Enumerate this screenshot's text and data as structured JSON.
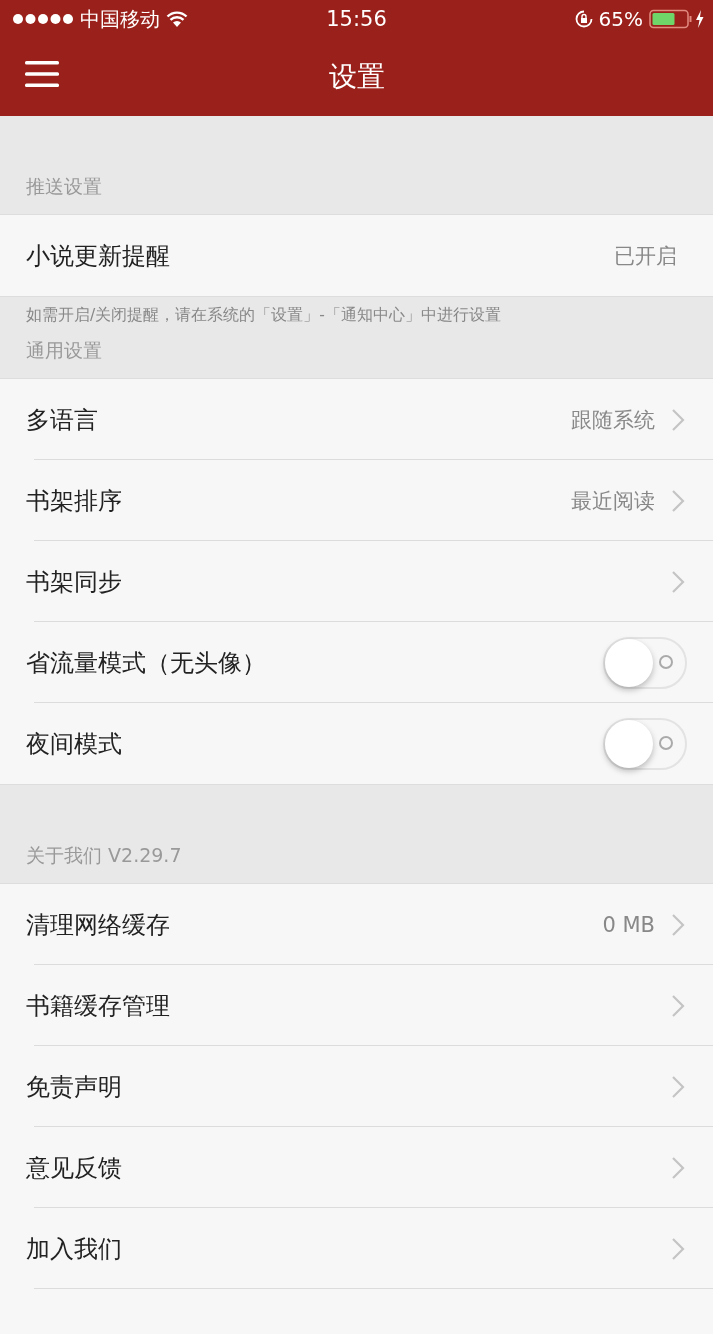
{
  "status_bar": {
    "carrier": "中国移动",
    "time": "15:56",
    "battery": "65%"
  },
  "nav": {
    "title": "设置"
  },
  "sections": [
    {
      "header": "推送设置",
      "rows": [
        {
          "kind": "value",
          "label": "小说更新提醒",
          "value": "已开启",
          "chevron": false
        }
      ],
      "note": "如需开启/关闭提醒，请在系统的「设置」-「通知中心」中进行设置"
    },
    {
      "header": "通用设置",
      "rows": [
        {
          "kind": "value",
          "label": "多语言",
          "value": "跟随系统",
          "chevron": true
        },
        {
          "kind": "value",
          "label": "书架排序",
          "value": "最近阅读",
          "chevron": true
        },
        {
          "kind": "value",
          "label": "书架同步",
          "chevron": true
        },
        {
          "kind": "toggle",
          "label": "省流量模式（无头像）",
          "on": false
        },
        {
          "kind": "toggle",
          "label": "夜间模式",
          "on": false
        }
      ]
    },
    {
      "header": "关于我们  V2.29.7",
      "rows": [
        {
          "kind": "value",
          "label": "清理网络缓存",
          "value": "0 MB",
          "chevron": true
        },
        {
          "kind": "value",
          "label": "书籍缓存管理",
          "chevron": true
        },
        {
          "kind": "value",
          "label": "免责声明",
          "chevron": true
        },
        {
          "kind": "value",
          "label": "意见反馈",
          "chevron": true
        },
        {
          "kind": "value",
          "label": "加入我们",
          "chevron": true
        }
      ]
    }
  ]
}
